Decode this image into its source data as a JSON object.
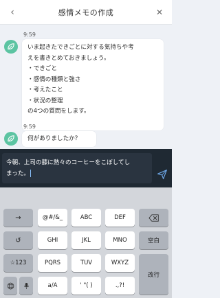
{
  "header": {
    "title": "感情メモの作成",
    "back_glyph": "‹",
    "close_glyph": "✕"
  },
  "chat": {
    "messages": [
      {
        "time": "9:59",
        "lines": [
          "いま起きたできごとに対する気持ちや考",
          "えを書きとめておきましょう。",
          "・できごと",
          "・感情の種類と強さ",
          "・考えたこと",
          "・状況の整理",
          "の4つの質問をします。"
        ]
      },
      {
        "time": "9:59",
        "lines": [
          "何がありましたか？"
        ]
      }
    ]
  },
  "input": {
    "lines": [
      "今朝、上司の膝に熱々のコーヒーをこぼしてし",
      "まった。"
    ]
  },
  "keyboard": {
    "keys": {
      "arrow": "→",
      "symbols": "@#/&_",
      "abc": "ABC",
      "def": "DEF",
      "undo": "↺",
      "ghi": "GHI",
      "jkl": "JKL",
      "mno": "MNO",
      "space": "空白",
      "num": "☆123",
      "pqrs": "PQRS",
      "tuv": "TUV",
      "wxyz": "WXYZ",
      "return": "改行",
      "case": "a/A",
      "quotes": "' \"( )",
      "punct": ".,?!"
    }
  },
  "colors": {
    "avatar": "#5cc4a2",
    "input_bar": "#1f2933",
    "keyboard_bg": "#d3d6db",
    "send_icon": "#6ea8e8"
  }
}
